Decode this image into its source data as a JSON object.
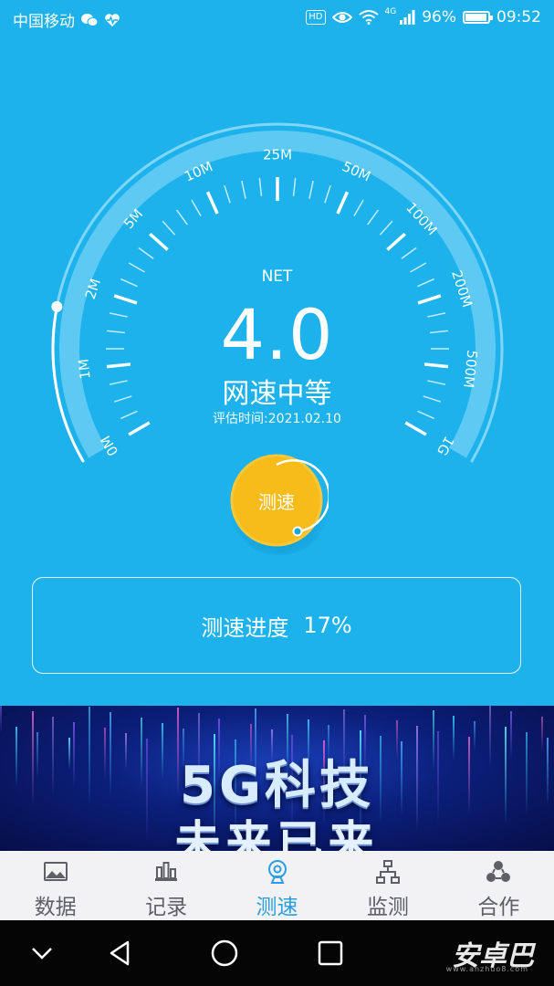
{
  "status_bar": {
    "carrier": "中国移动",
    "network": "4G",
    "battery": "96%",
    "battery_level": 0.96,
    "time": "09:52",
    "icons": [
      "wechat-icon",
      "health-icon",
      "hd-icon",
      "eye-icon",
      "wifi-icon",
      "signal-icon",
      "battery-icon"
    ]
  },
  "gauge": {
    "scale_labels": [
      "0M",
      "1M",
      "2M",
      "5M",
      "10M",
      "25M",
      "50M",
      "100M",
      "200M",
      "500M",
      "1G"
    ],
    "net_label": "NET",
    "speed_value": "4.0",
    "speed_level": "网速中等",
    "eval_time": "评估时间:2021.02.10"
  },
  "test_button": {
    "label": "测速"
  },
  "progress": {
    "label": "测速进度",
    "percent": "17%",
    "value": 0.17
  },
  "banner": {
    "line1": "5G科技",
    "line2": "未来已来"
  },
  "tab_bar": {
    "items": [
      {
        "label": "数据",
        "icon": "image-icon",
        "active": false
      },
      {
        "label": "记录",
        "icon": "bar-chart-icon",
        "active": false
      },
      {
        "label": "测速",
        "icon": "webcam-icon",
        "active": true
      },
      {
        "label": "监测",
        "icon": "network-icon",
        "active": false
      },
      {
        "label": "合作",
        "icon": "cooperation-icon",
        "active": false
      }
    ]
  },
  "nav_bar": {
    "buttons": [
      "chevron-down-icon",
      "back-icon",
      "home-icon",
      "recents-icon"
    ],
    "watermark": "安卓巴",
    "watermark_sub": "www.anzhuo8.com"
  },
  "colors": {
    "background": "#1db2ec",
    "gauge_arc": "#7fd6f7",
    "button": "#f7bc1a",
    "tab_active": "#2d9fe0",
    "tab_inactive": "#5e6066"
  }
}
